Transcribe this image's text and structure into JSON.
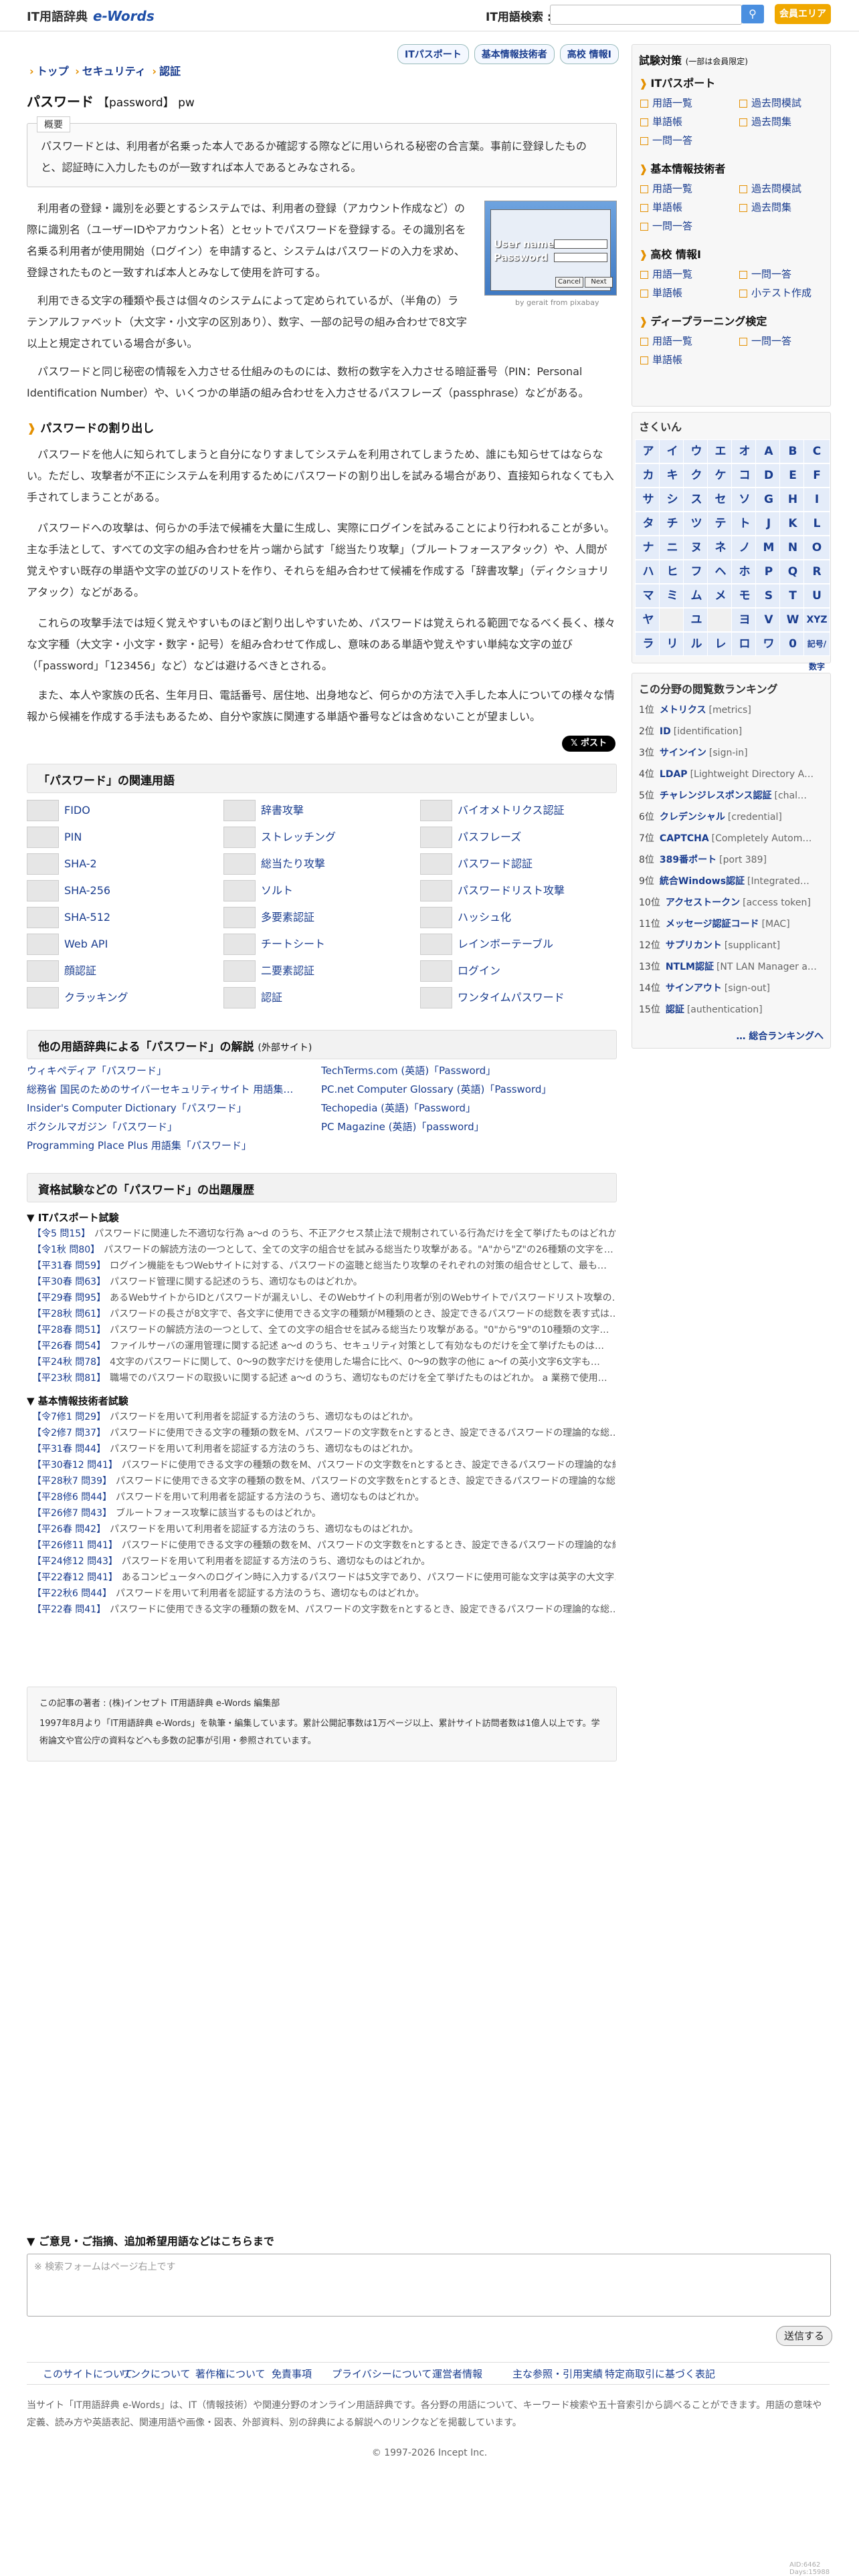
{
  "header": {
    "logo_text": "IT用語辞典",
    "logo_brand": "e-Words",
    "search_label": "IT用語検索 :",
    "search_placeholder": "",
    "member_button": "会員エリア"
  },
  "breadcrumb": [
    "トップ",
    "セキュリティ",
    "認証"
  ],
  "quick_tags": [
    "ITパスポート",
    "基本情報技術者",
    "高校 情報I"
  ],
  "title": {
    "term": "パスワード",
    "reading": "【password】 pw"
  },
  "summary": {
    "label": "概要",
    "text": "パスワードとは、利用者が名乗った本人であるか確認する際などに用いられる秘密の合言葉。事前に登録したものと、認証時に入力したものが一致すれば本人であるとみなされる。"
  },
  "image": {
    "user_label": "User name",
    "pw_label": "Password",
    "cancel": "Cancel",
    "next": "Next",
    "caption": "by gerait from pixabay"
  },
  "paragraphs": [
    "利用者の登録・識別を必要とするシステムでは、利用者の登録（アカウント作成など）の際に識別名（ユーザーIDやアカウント名）とセットでパスワードを登録する。その識別名を名乗る利用者が使用開始（ログイン）を申請すると、システムはパスワードの入力を求め、登録されたものと一致すれば本人とみなして使用を許可する。",
    "利用できる文字の種類や長さは個々のシステムによって定められているが、（半角の）ラテンアルファベット（大文字・小文字の区別あり）、数字、一部の記号の組み合わせで8文字以上と規定されている場合が多い。",
    "パスワードと同じ秘密の情報を入力させる仕組みのものには、数桁の数字を入力させる暗証番号（PIN：Personal Identification Number）や、いくつかの単語の組み合わせを入力させるパスフレーズ（passphrase）などがある。",
    "パスワードを他人に知られてしまうと自分になりすましてシステムを利用されてしまうため、誰にも知らせてはならない。ただし、攻撃者が不正にシステムを利用するためにパスワードの割り出しを試みる場合があり、直接知られなくても入手されてしまうことがある。",
    "パスワードへの攻撃は、何らかの手法で候補を大量に生成し、実際にログインを試みることにより行われることが多い。主な手法として、すべての文字の組み合わせを片っ端から試す「総当たり攻撃」（ブルートフォースアタック）や、人間が覚えやすい既存の単語や文字の並びのリストを作り、それらを組み合わせて候補を作成する「辞書攻撃」（ディクショナリアタック）などがある。",
    "これらの攻撃手法では短く覚えやすいものほど割り出しやすいため、パスワードは覚えられる範囲でなるべく長く、様々な文字種（大文字・小文字・数字・記号）を組み合わせて作成し、意味のある単語や覚えやすい単純な文字の並び（「password」「123456」など）などは避けるべきとされる。",
    "また、本人や家族の氏名、生年月日、電話番号、居住地、出身地など、何らかの方法で入手した本人についての様々な情報から候補を作成する手法もあるため、自分や家族に関連する単語や番号などは含めないことが望ましい。"
  ],
  "section_crack": "パスワードの割り出し",
  "tweet": "𝕏 ポスト",
  "related": {
    "heading": "「パスワード」の関連用語",
    "items": [
      "FIDO",
      "辞書攻撃",
      "バイオメトリクス認証",
      "PIN",
      "ストレッチング",
      "パスフレーズ",
      "SHA-2",
      "総当たり攻撃",
      "パスワード認証",
      "SHA-256",
      "ソルト",
      "パスワードリスト攻撃",
      "SHA-512",
      "多要素認証",
      "ハッシュ化",
      "Web API",
      "チートシート",
      "レインボーテーブル",
      "顔認証",
      "二要素認証",
      "ログイン",
      "クラッキング",
      "認証",
      "ワンタイムパスワード"
    ]
  },
  "external": {
    "heading": "他の用語辞典による「パスワード」の解説",
    "heading_small": "(外部サイト)",
    "items": [
      "ウィキペディア「パスワード」",
      "TechTerms.com (英語)「Password」",
      "総務省 国民のためのサイバーセキュリティサイト 用語集…",
      "PC.net Computer Glossary (英語)「Password」",
      "Insider's Computer Dictionary「パスワード」",
      "Techopedia (英語)「Password」",
      "ボクシルマガジン「パスワード」",
      "PC Magazine (英語)「password」",
      "Programming Place Plus 用語集「パスワード」"
    ]
  },
  "exams": {
    "heading": "資格試験などの「パスワード」の出題履歴",
    "groups": [
      {
        "name": "▼ ITパスポート試験",
        "items": [
          [
            "【令5 問15】",
            "パスワードに関連した不適切な行為 a〜d のうち、不正アクセス禁止法で規制されている行為だけを全て挙げたものはどれか。"
          ],
          [
            "【令1秋 問80】",
            "パスワードの解読方法の一つとして、全ての文字の組合せを試みる総当たり攻撃がある。\"A\"から\"Z\"の26種類の文字を…"
          ],
          [
            "【平31春 問59】",
            "ログイン機能をもつWebサイトに対する、パスワードの盗聴と総当たり攻撃のそれぞれの対策の組合せとして、最も…"
          ],
          [
            "【平30春 問63】",
            "パスワード管理に関する記述のうち、適切なものはどれか。"
          ],
          [
            "【平29春 問95】",
            "あるWebサイトからIDとパスワードが漏えいし、そのWebサイトの利用者が別のWebサイトでパスワードリスト攻撃の…"
          ],
          [
            "【平28秋 問61】",
            "パスワードの長さが8文字で、各文字に使用できる文字の種類がM種類のとき、設定できるパスワードの総数を表す式は…"
          ],
          [
            "【平28春 問51】",
            "パスワードの解読方法の一つとして、全ての文字の組合せを試みる総当たり攻撃がある。\"0\"から\"9\"の10種類の文字…"
          ],
          [
            "【平26春 問54】",
            "ファイルサーバの運用管理に関する記述 a〜d のうち、セキュリティ対策として有効なものだけを全て挙げたものは…"
          ],
          [
            "【平24秋 問78】",
            "4文字のパスワードに関して、0〜9の数字だけを使用した場合に比べ、0〜9の数字の他に a〜f の英小文字6文字も…"
          ],
          [
            "【平23秋 問81】",
            "職場でのパスワードの取扱いに関する記述 a〜d のうち、適切なものだけを全て挙げたものはどれか。 a 業務で使用…"
          ]
        ]
      },
      {
        "name": "▼ 基本情報技術者試験",
        "items": [
          [
            "【令7修1 問29】",
            "パスワードを用いて利用者を認証する方法のうち、適切なものはどれか。"
          ],
          [
            "【令2修7 問37】",
            "パスワードに使用できる文字の種類の数をM、パスワードの文字数をnとするとき、設定できるパスワードの理論的な総…"
          ],
          [
            "【平31春 問44】",
            "パスワードを用いて利用者を認証する方法のうち、適切なものはどれか。"
          ],
          [
            "【平30春12 問41】",
            "パスワードに使用できる文字の種類の数をM、パスワードの文字数をnとするとき、設定できるパスワードの理論的な総…"
          ],
          [
            "【平28秋7 問39】",
            "パスワードに使用できる文字の種類の数をM、パスワードの文字数をnとするとき、設定できるパスワードの理論的な総…"
          ],
          [
            "【平28修6 問44】",
            "パスワードを用いて利用者を認証する方法のうち、適切なものはどれか。"
          ],
          [
            "【平26修7 問43】",
            "ブルートフォース攻撃に該当するものはどれか。"
          ],
          [
            "【平26春 問42】",
            "パスワードを用いて利用者を認証する方法のうち、適切なものはどれか。"
          ],
          [
            "【平26修11 問41】",
            "パスワードに使用できる文字の種類の数をM、パスワードの文字数をnとするとき、設定できるパスワードの理論的な総…"
          ],
          [
            "【平24修12 問43】",
            "パスワードを用いて利用者を認証する方法のうち、適切なものはどれか。"
          ],
          [
            "【平22春12 問41】",
            "あるコンピュータへのログイン時に入力するパスワードは5文字であり、パスワードに使用可能な文字は英字の大文字…"
          ],
          [
            "【平22秋6 問44】",
            "パスワードを用いて利用者を認証する方法のうち、適切なものはどれか。"
          ],
          [
            "【平22春 問41】",
            "パスワードに使用できる文字の種類の数をM、パスワードの文字数をnとするとき、設定できるパスワードの理論的な総…"
          ]
        ]
      }
    ]
  },
  "author": {
    "line1": "この記事の著者 : (株)インセプト IT用語辞典 e-Words 編集部",
    "line2": "1997年8月より「IT用語辞典 e-Words」を執筆・編集しています。累計公開記事数は1万ページ以上、累計サイト訪問者数は1億人以上です。学術論文や官公庁の資料などへも多数の記事が引用・参照されています。"
  },
  "feedback": {
    "heading": "▼ ご意見・ご指摘、追加希望用語などはこちらまで",
    "placeholder": "※ 検索フォームはページ右上です",
    "send": "送信する"
  },
  "footer_links": [
    "このサイトについて",
    "リンクについて",
    "著作権について",
    "免責事項",
    "プライバシーについて",
    "運営者情報",
    "主な参照・引用実績",
    "特定商取引に基づく表記"
  ],
  "footer_desc": "当サイト「IT用語辞典 e-Words」は、IT（情報技術）や関連分野のオンライン用語辞典です。各分野の用語について、キーワード検索や五十音索引から調べることができます。用語の意味や定義、読み方や英語表記、関連用語や画像・図表、外部資料、別の辞典による解説へのリンクなどを掲載しています。",
  "copyright": "© 1997-2026 Incept Inc.",
  "footer_id": "AID:6462  Days:15988",
  "sidebar": {
    "exam_heading": "試験対策",
    "exam_heading_sm": "(一部は会員限定)",
    "groups": [
      {
        "name": "ITパスポート",
        "links": [
          "用語一覧",
          "過去問模試",
          "単語帳",
          "過去問集",
          "一問一答"
        ]
      },
      {
        "name": "基本情報技術者",
        "links": [
          "用語一覧",
          "過去問模試",
          "単語帳",
          "過去問集",
          "一問一答"
        ]
      },
      {
        "name": "高校 情報I",
        "links": [
          "用語一覧",
          "一問一答",
          "単語帳",
          "小テスト作成"
        ]
      },
      {
        "name": "ディープラーニング検定",
        "links": [
          "用語一覧",
          "一問一答",
          "単語帳"
        ]
      }
    ],
    "index_heading": "さくいん",
    "kana": [
      "ア",
      "イ",
      "ウ",
      "エ",
      "オ",
      "A",
      "B",
      "C",
      "カ",
      "キ",
      "ク",
      "ケ",
      "コ",
      "D",
      "E",
      "F",
      "サ",
      "シ",
      "ス",
      "セ",
      "ソ",
      "G",
      "H",
      "I",
      "タ",
      "チ",
      "ツ",
      "テ",
      "ト",
      "J",
      "K",
      "L",
      "ナ",
      "ニ",
      "ヌ",
      "ネ",
      "ノ",
      "M",
      "N",
      "O",
      "ハ",
      "ヒ",
      "フ",
      "ヘ",
      "ホ",
      "P",
      "Q",
      "R",
      "マ",
      "ミ",
      "ム",
      "メ",
      "モ",
      "S",
      "T",
      "U",
      "ヤ",
      "",
      "ユ",
      "",
      "ヨ",
      "V",
      "W",
      "XYZ",
      "ラ",
      "リ",
      "ル",
      "レ",
      "ロ",
      "ワ",
      "0",
      "記号/数字"
    ],
    "rank_heading": "この分野の閲覧数ランキング",
    "ranking": [
      [
        "1位",
        "メトリクス",
        "[metrics]"
      ],
      [
        "2位",
        "ID",
        "[identification]"
      ],
      [
        "3位",
        "サインイン",
        "[sign-in]"
      ],
      [
        "4位",
        "LDAP",
        "[Lightweight Directory A…"
      ],
      [
        "5位",
        "チャレンジレスポンス認証",
        "[chal…"
      ],
      [
        "6位",
        "クレデンシャル",
        "[credential]"
      ],
      [
        "7位",
        "CAPTCHA",
        "[Completely Autom…"
      ],
      [
        "8位",
        "389番ポート",
        "[port 389]"
      ],
      [
        "9位",
        "統合Windows認証",
        "[Integrated…"
      ],
      [
        "10位",
        "アクセストークン",
        "[access token]"
      ],
      [
        "11位",
        "メッセージ認証コード",
        "[MAC]"
      ],
      [
        "12位",
        "サプリカント",
        "[supplicant]"
      ],
      [
        "13位",
        "NTLM認証",
        "[NT LAN Manager a…"
      ],
      [
        "14位",
        "サインアウト",
        "[sign-out]"
      ],
      [
        "15位",
        "認証",
        "[authentication]"
      ]
    ],
    "rank_more": "… 総合ランキングへ"
  }
}
